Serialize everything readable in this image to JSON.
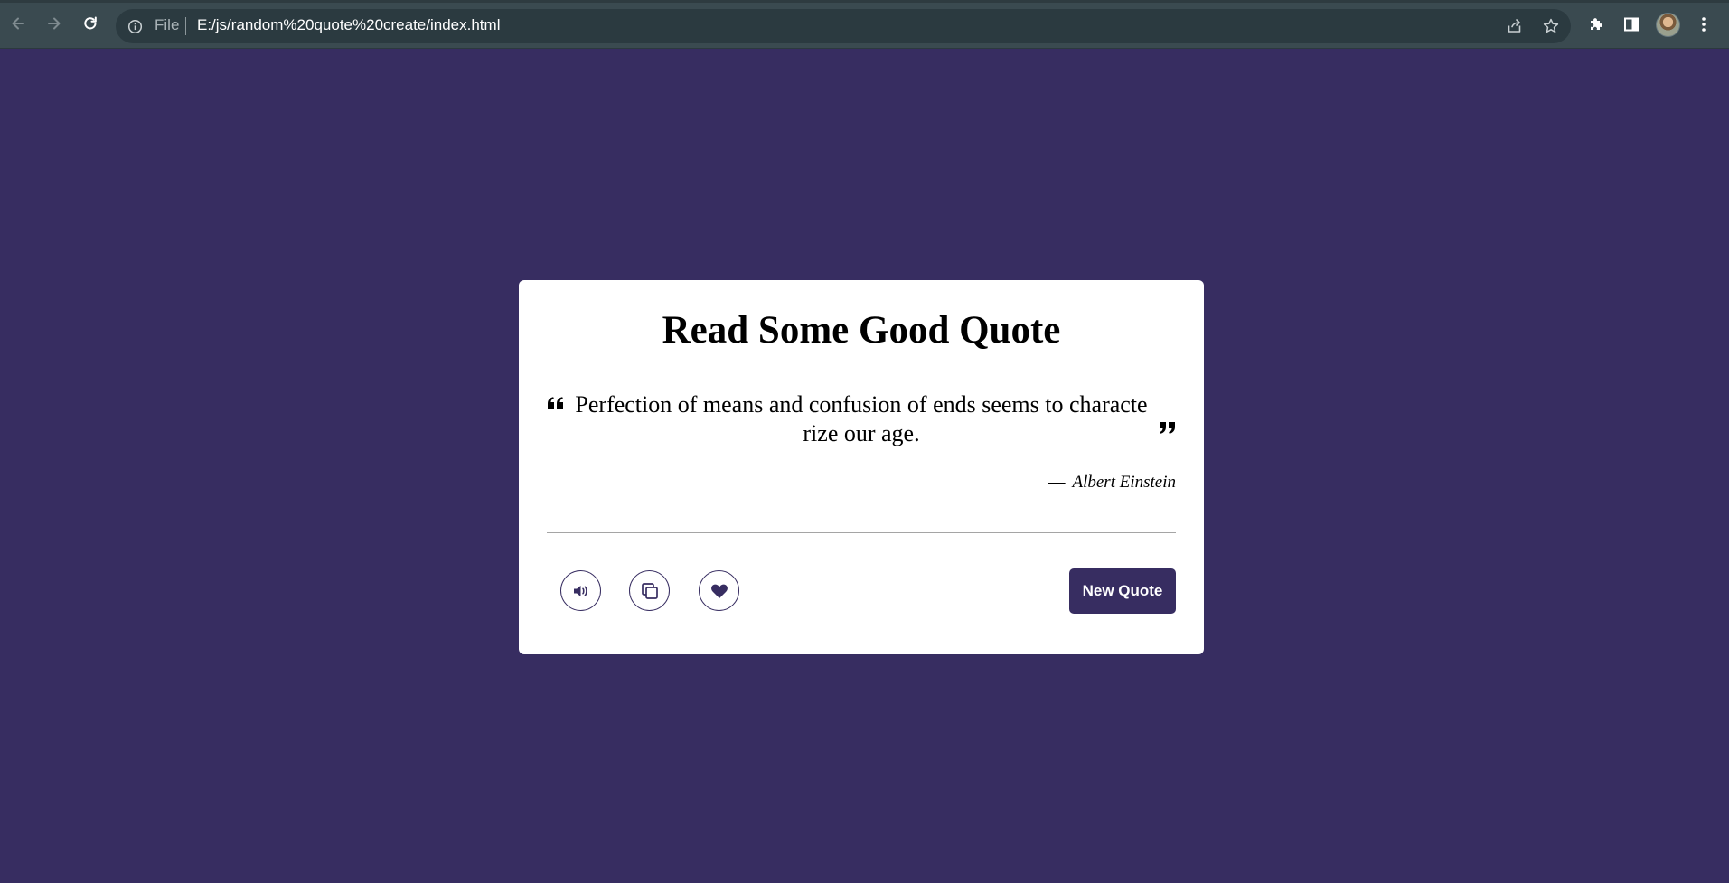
{
  "browser": {
    "address_scheme": "File",
    "address_url": "E:/js/random%20quote%20create/index.html"
  },
  "card": {
    "title": "Read Some Good Quote",
    "quote": "Perfection of means and confusion of ends seems to characterize our age.",
    "author_dash": "—",
    "author": "Albert Einstein",
    "new_quote_label": "New Quote"
  },
  "colors": {
    "page_background": "#372d61",
    "accent": "#372d61",
    "card_background": "#ffffff",
    "browser_toolbar": "#3a4a50"
  },
  "icons": {
    "back": "arrow-left-icon",
    "forward": "arrow-right-icon",
    "reload": "reload-icon",
    "site_info": "info-icon",
    "share": "share-icon",
    "bookmark": "star-icon",
    "extensions": "puzzle-icon",
    "side_panel": "side-panel-icon",
    "menu": "kebab-menu-icon",
    "speak": "speaker-icon",
    "copy": "copy-icon",
    "like": "heart-icon",
    "quote_open": "quote-left-icon",
    "quote_close": "quote-right-icon"
  }
}
